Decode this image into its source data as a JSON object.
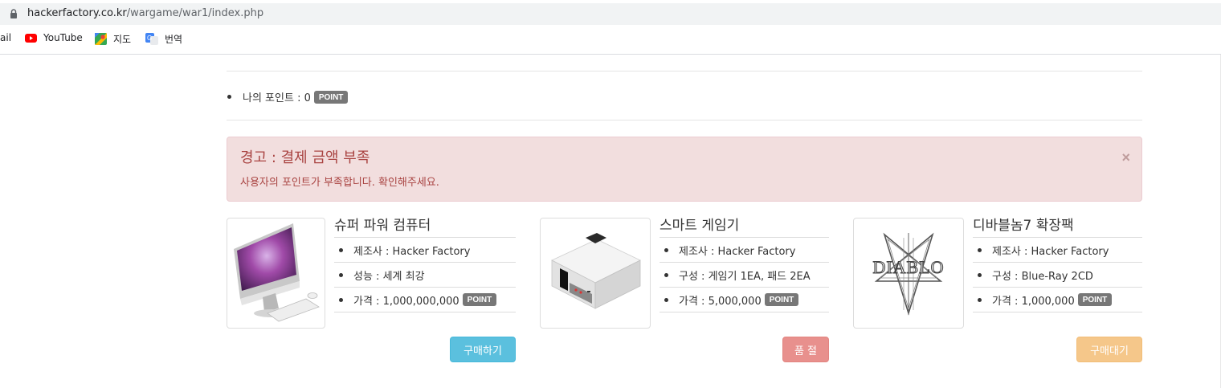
{
  "browser": {
    "url_host": "hackerfactory.co.kr",
    "url_path": "/wargame/war1/index.php",
    "bookmarks": [
      {
        "label": "ail",
        "icon": "gmail-icon"
      },
      {
        "label": "YouTube",
        "icon": "youtube-icon"
      },
      {
        "label": "지도",
        "icon": "maps-icon"
      },
      {
        "label": "번역",
        "icon": "translate-icon"
      }
    ]
  },
  "points": {
    "label": "나의 포인트 : 0",
    "unit": "POINT"
  },
  "alert": {
    "title": "경고 : 결제 금액 부족",
    "message": "사용자의 포인트가 부족합니다. 확인해주세요.",
    "close": "×"
  },
  "products": [
    {
      "name": "슈퍼 파워 컴퓨터",
      "specs": [
        "제조사 : Hacker Factory",
        "성능 : 세계 최강",
        "가격 : 1,000,000,000"
      ],
      "price_unit": "POINT",
      "button_label": "구매하기",
      "button_color": "#5bc0de"
    },
    {
      "name": "스마트 게임기",
      "specs": [
        "제조사 : Hacker Factory",
        "구성 : 게임기 1EA, 패드 2EA",
        "가격 : 5,000,000"
      ],
      "price_unit": "POINT",
      "button_label": "품 절",
      "button_color": "#e8908d"
    },
    {
      "name": "디바블놈7 확장팩",
      "specs": [
        "제조사 : Hacker Factory",
        "구성 : Blue-Ray 2CD",
        "가격 : 1,000,000"
      ],
      "price_unit": "POINT",
      "button_label": "구매대기",
      "button_color": "#f5c78a"
    }
  ],
  "thumb_text": {
    "diablo_logo": "DIABLO"
  }
}
